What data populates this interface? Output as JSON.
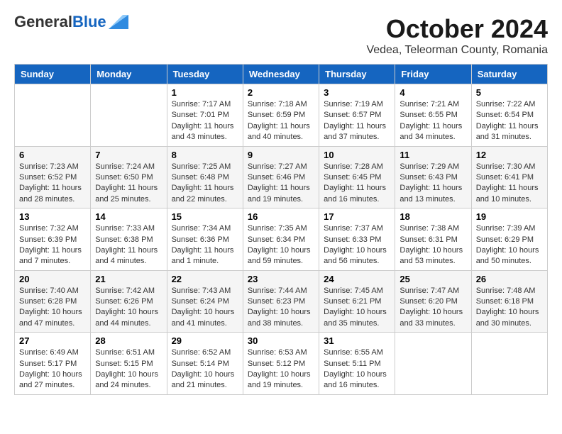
{
  "logo": {
    "general": "General",
    "blue": "Blue"
  },
  "title": "October 2024",
  "subtitle": "Vedea, Teleorman County, Romania",
  "headers": [
    "Sunday",
    "Monday",
    "Tuesday",
    "Wednesday",
    "Thursday",
    "Friday",
    "Saturday"
  ],
  "weeks": [
    [
      {
        "day": "",
        "info": ""
      },
      {
        "day": "",
        "info": ""
      },
      {
        "day": "1",
        "info": "Sunrise: 7:17 AM\nSunset: 7:01 PM\nDaylight: 11 hours and 43 minutes."
      },
      {
        "day": "2",
        "info": "Sunrise: 7:18 AM\nSunset: 6:59 PM\nDaylight: 11 hours and 40 minutes."
      },
      {
        "day": "3",
        "info": "Sunrise: 7:19 AM\nSunset: 6:57 PM\nDaylight: 11 hours and 37 minutes."
      },
      {
        "day": "4",
        "info": "Sunrise: 7:21 AM\nSunset: 6:55 PM\nDaylight: 11 hours and 34 minutes."
      },
      {
        "day": "5",
        "info": "Sunrise: 7:22 AM\nSunset: 6:54 PM\nDaylight: 11 hours and 31 minutes."
      }
    ],
    [
      {
        "day": "6",
        "info": "Sunrise: 7:23 AM\nSunset: 6:52 PM\nDaylight: 11 hours and 28 minutes."
      },
      {
        "day": "7",
        "info": "Sunrise: 7:24 AM\nSunset: 6:50 PM\nDaylight: 11 hours and 25 minutes."
      },
      {
        "day": "8",
        "info": "Sunrise: 7:25 AM\nSunset: 6:48 PM\nDaylight: 11 hours and 22 minutes."
      },
      {
        "day": "9",
        "info": "Sunrise: 7:27 AM\nSunset: 6:46 PM\nDaylight: 11 hours and 19 minutes."
      },
      {
        "day": "10",
        "info": "Sunrise: 7:28 AM\nSunset: 6:45 PM\nDaylight: 11 hours and 16 minutes."
      },
      {
        "day": "11",
        "info": "Sunrise: 7:29 AM\nSunset: 6:43 PM\nDaylight: 11 hours and 13 minutes."
      },
      {
        "day": "12",
        "info": "Sunrise: 7:30 AM\nSunset: 6:41 PM\nDaylight: 11 hours and 10 minutes."
      }
    ],
    [
      {
        "day": "13",
        "info": "Sunrise: 7:32 AM\nSunset: 6:39 PM\nDaylight: 11 hours and 7 minutes."
      },
      {
        "day": "14",
        "info": "Sunrise: 7:33 AM\nSunset: 6:38 PM\nDaylight: 11 hours and 4 minutes."
      },
      {
        "day": "15",
        "info": "Sunrise: 7:34 AM\nSunset: 6:36 PM\nDaylight: 11 hours and 1 minute."
      },
      {
        "day": "16",
        "info": "Sunrise: 7:35 AM\nSunset: 6:34 PM\nDaylight: 10 hours and 59 minutes."
      },
      {
        "day": "17",
        "info": "Sunrise: 7:37 AM\nSunset: 6:33 PM\nDaylight: 10 hours and 56 minutes."
      },
      {
        "day": "18",
        "info": "Sunrise: 7:38 AM\nSunset: 6:31 PM\nDaylight: 10 hours and 53 minutes."
      },
      {
        "day": "19",
        "info": "Sunrise: 7:39 AM\nSunset: 6:29 PM\nDaylight: 10 hours and 50 minutes."
      }
    ],
    [
      {
        "day": "20",
        "info": "Sunrise: 7:40 AM\nSunset: 6:28 PM\nDaylight: 10 hours and 47 minutes."
      },
      {
        "day": "21",
        "info": "Sunrise: 7:42 AM\nSunset: 6:26 PM\nDaylight: 10 hours and 44 minutes."
      },
      {
        "day": "22",
        "info": "Sunrise: 7:43 AM\nSunset: 6:24 PM\nDaylight: 10 hours and 41 minutes."
      },
      {
        "day": "23",
        "info": "Sunrise: 7:44 AM\nSunset: 6:23 PM\nDaylight: 10 hours and 38 minutes."
      },
      {
        "day": "24",
        "info": "Sunrise: 7:45 AM\nSunset: 6:21 PM\nDaylight: 10 hours and 35 minutes."
      },
      {
        "day": "25",
        "info": "Sunrise: 7:47 AM\nSunset: 6:20 PM\nDaylight: 10 hours and 33 minutes."
      },
      {
        "day": "26",
        "info": "Sunrise: 7:48 AM\nSunset: 6:18 PM\nDaylight: 10 hours and 30 minutes."
      }
    ],
    [
      {
        "day": "27",
        "info": "Sunrise: 6:49 AM\nSunset: 5:17 PM\nDaylight: 10 hours and 27 minutes."
      },
      {
        "day": "28",
        "info": "Sunrise: 6:51 AM\nSunset: 5:15 PM\nDaylight: 10 hours and 24 minutes."
      },
      {
        "day": "29",
        "info": "Sunrise: 6:52 AM\nSunset: 5:14 PM\nDaylight: 10 hours and 21 minutes."
      },
      {
        "day": "30",
        "info": "Sunrise: 6:53 AM\nSunset: 5:12 PM\nDaylight: 10 hours and 19 minutes."
      },
      {
        "day": "31",
        "info": "Sunrise: 6:55 AM\nSunset: 5:11 PM\nDaylight: 10 hours and 16 minutes."
      },
      {
        "day": "",
        "info": ""
      },
      {
        "day": "",
        "info": ""
      }
    ]
  ]
}
